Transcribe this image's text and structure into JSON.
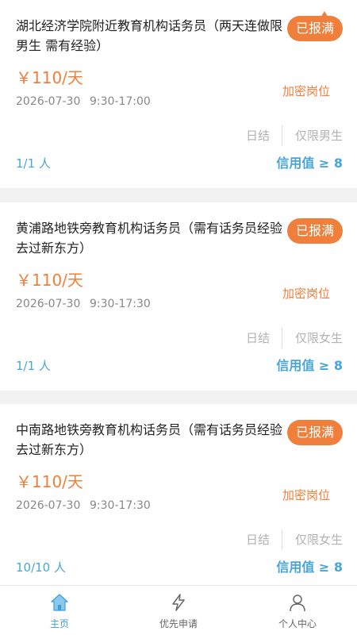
{
  "jobs": [
    {
      "title": "湖北经济学院附近教育机构话务员（两天连做限男生 需有经验）",
      "status": "已报满",
      "price": "￥110/天",
      "date": "2026-07-30",
      "time": "9:30-17:00",
      "encrypted": "加密岗位",
      "tag_settle": "日结",
      "tag_gender": "仅限男生",
      "count": "1/1 人",
      "credit": "信用值 ≥ 8"
    },
    {
      "title": "黄浦路地铁旁教育机构话务员（需有话务员经验去过新东方）",
      "status": "已报满",
      "price": "￥110/天",
      "date": "2026-07-30",
      "time": "9:30-17:30",
      "encrypted": "加密岗位",
      "tag_settle": "日结",
      "tag_gender": "仅限女生",
      "count": "1/1 人",
      "credit": "信用值 ≥ 8"
    },
    {
      "title": "中南路地铁旁教育机构话务员（需有话务员经验去过新东方）",
      "status": "已报满",
      "price": "￥110/天",
      "date": "2026-07-30",
      "time": "9:30-17:30",
      "encrypted": "加密岗位",
      "tag_settle": "日结",
      "tag_gender": "仅限女生",
      "count": "10/10 人",
      "credit": "信用值 ≥ 8"
    }
  ],
  "tabbar": {
    "items": [
      {
        "label": "主页",
        "icon": "home-icon",
        "active": true
      },
      {
        "label": "优先申请",
        "icon": "lightning-icon",
        "active": false
      },
      {
        "label": "个人中心",
        "icon": "person-icon",
        "active": false
      }
    ]
  },
  "colors": {
    "accent_orange": "#f07f3c",
    "accent_blue": "#4aa6d8",
    "muted_text": "#888888"
  }
}
